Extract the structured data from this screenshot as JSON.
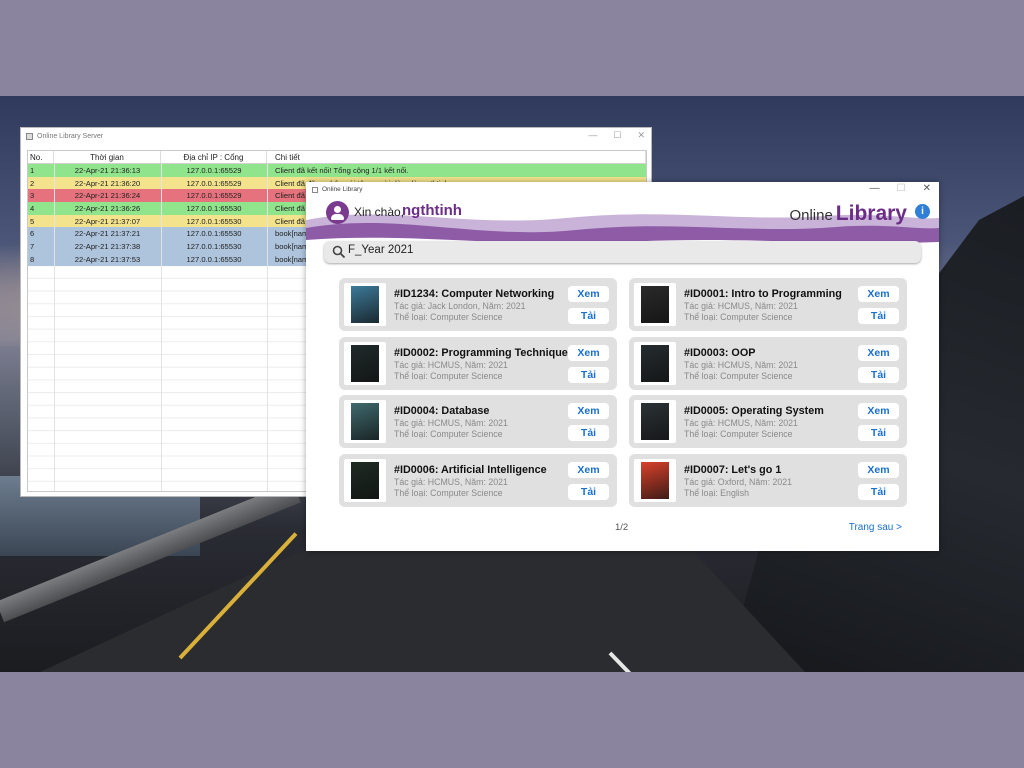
{
  "server": {
    "title": "Online Library Server",
    "columns": [
      "No.",
      "Thời gian",
      "Địa chỉ IP : Cổng",
      "Chi tiết"
    ],
    "rows": [
      {
        "no": "1",
        "time": "22-Apr-21 21:36:13",
        "ip": "127.0.0.1:65529",
        "detail": "Client đã kết nối! Tổng cộng 1/1 kết nối.",
        "color": "#90e58c"
      },
      {
        "no": "2",
        "time": "22-Apr-21 21:36:20",
        "ip": "127.0.0.1:65529",
        "detail": "Client đã đăng nhập với tên người dùng là: ngthtinh",
        "color": "#f3e38c"
      },
      {
        "no": "3",
        "time": "22-Apr-21 21:36:24",
        "ip": "127.0.0.1:65529",
        "detail": "Client đã",
        "color": "#e5727c"
      },
      {
        "no": "4",
        "time": "22-Apr-21 21:36:26",
        "ip": "127.0.0.1:65530",
        "detail": "Client đã",
        "color": "#90e58c"
      },
      {
        "no": "5",
        "time": "22-Apr-21 21:37:07",
        "ip": "127.0.0.1:65530",
        "detail": "Client đã",
        "color": "#f3e38c"
      },
      {
        "no": "6",
        "time": "22-Apr-21 21:37:21",
        "ip": "127.0.0.1:65530",
        "detail": "book[nam",
        "color": "#aec4dd"
      },
      {
        "no": "7",
        "time": "22-Apr-21 21:37:38",
        "ip": "127.0.0.1:65530",
        "detail": "book[nam",
        "color": "#aec4dd"
      },
      {
        "no": "8",
        "time": "22-Apr-21 21:37:53",
        "ip": "127.0.0.1:65530",
        "detail": "book[nam",
        "color": "#aec4dd"
      }
    ]
  },
  "library": {
    "title": "Online Library",
    "greeting": "Xin chào,",
    "username": "ngthtinh",
    "brand_prefix": "Online",
    "brand_main": "Library",
    "search_query": "F_Year 2021",
    "view_label": "Xem",
    "download_label": "Tải",
    "books": [
      {
        "title": "#ID1234: Computer Networking",
        "meta": "Tác giả: Jack London, Năm: 2021",
        "genre": "Thể loại: Computer Science",
        "cover": "#3d7a9a"
      },
      {
        "title": "#ID0001: Intro to Programming",
        "meta": "Tác giả: HCMUS, Năm: 2021",
        "genre": "Thể loại: Computer Science",
        "cover": "#2a2a2a"
      },
      {
        "title": "#ID0002: Programming Technique",
        "meta": "Tác giả: HCMUS, Năm: 2021",
        "genre": "Thể loại: Computer Science",
        "cover": "#1f2a2a"
      },
      {
        "title": "#ID0003: OOP",
        "meta": "Tác giả: HCMUS, Năm: 2021",
        "genre": "Thể loại: Computer Science",
        "cover": "#252c30"
      },
      {
        "title": "#ID0004: Database",
        "meta": "Tác giả: HCMUS, Năm: 2021",
        "genre": "Thể loại: Computer Science",
        "cover": "#3f6a6e"
      },
      {
        "title": "#ID0005: Operating System",
        "meta": "Tác giả: HCMUS, Năm: 2021",
        "genre": "Thể loại: Computer Science",
        "cover": "#2b3236"
      },
      {
        "title": "#ID0006: Artificial Intelligence",
        "meta": "Tác giả: HCMUS, Năm: 2021",
        "genre": "Thể loại: Computer Science",
        "cover": "#1d2b22"
      },
      {
        "title": "#ID0007: Let's go 1",
        "meta": "Tác giả: Oxford, Năm: 2021",
        "genre": "Thể loại: English",
        "cover": "#d9412b"
      }
    ],
    "page_indicator": "1/2",
    "next_label": "Trang sau >"
  }
}
